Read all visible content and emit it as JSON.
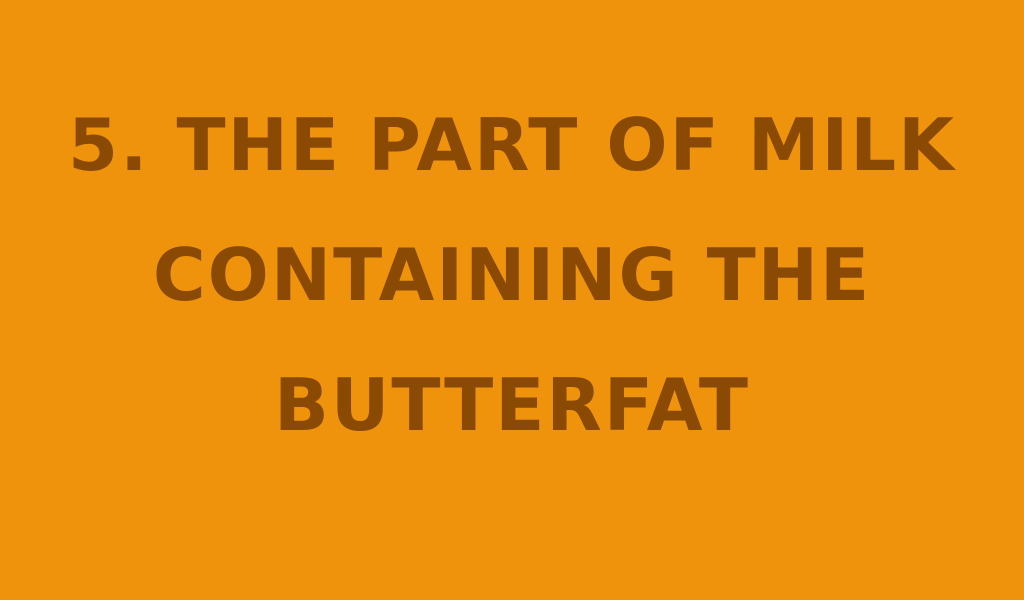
{
  "slide": {
    "background_color": "#EE930B",
    "text_color": "#8B4A04",
    "clue_lines": [
      "5. THE PART OF MILK",
      "CONTAINING THE",
      "BUTTERFAT"
    ]
  }
}
